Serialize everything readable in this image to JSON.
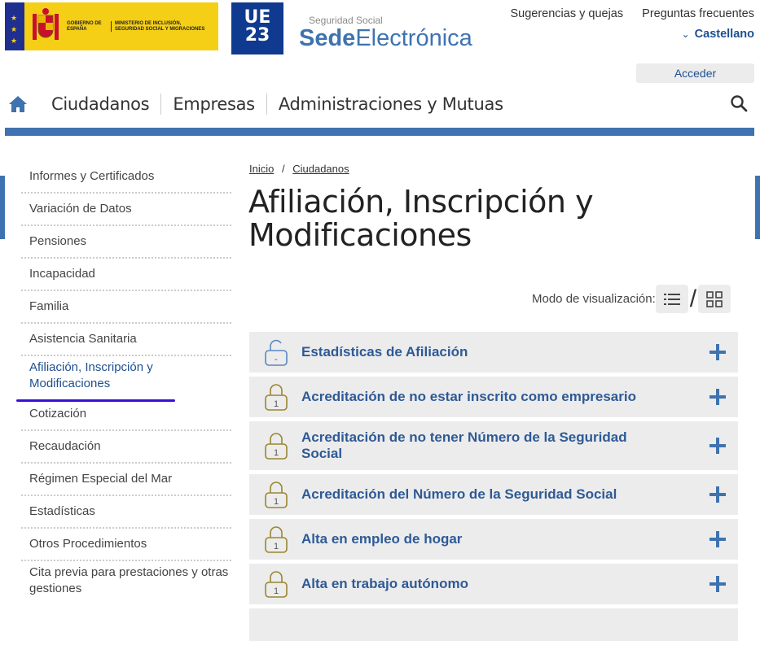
{
  "header": {
    "gov_text_1": "GOBIERNO DE ESPAÑA",
    "gov_text_2": "MINISTERIO DE INCLUSIÓN, SEGURIDAD SOCIAL Y MIGRACIONES",
    "u23_line1": "UE",
    "u23_line2": "23",
    "sede_small": "Seguridad Social",
    "sede_bold": "Sede",
    "sede_light": "Electrónica",
    "link_suggestions": "Sugerencias y quejas",
    "link_faq": "Preguntas frecuentes",
    "language": "Castellano",
    "login_button": "Acceder"
  },
  "nav": {
    "items": [
      "Ciudadanos",
      "Empresas",
      "Administraciones y Mutuas"
    ]
  },
  "sidebar": {
    "items": [
      "Informes y Certificados",
      "Variación de Datos",
      "Pensiones",
      "Incapacidad",
      "Familia",
      "Asistencia Sanitaria",
      "Afiliación, Inscripción y Modificaciones",
      "Cotización",
      "Recaudación",
      "Régimen Especial del Mar",
      "Estadísticas",
      "Otros Procedimientos",
      "Cita previa para prestaciones y otras gestiones"
    ],
    "active_index": 6
  },
  "breadcrumb": {
    "home": "Inicio",
    "separator": "/",
    "section": "Ciudadanos"
  },
  "page_title": "Afiliación, Inscripción y Modificaciones",
  "view_mode": {
    "label": "Modo de visualización:",
    "separator": "/"
  },
  "procedures": [
    {
      "label": "Estadísticas de Afiliación",
      "lock": "open",
      "lock_text": "-"
    },
    {
      "label": "Acreditación de no estar inscrito como empresario",
      "lock": "closed",
      "lock_text": "1"
    },
    {
      "label": "Acreditación de no tener Número de la Seguridad Social",
      "lock": "closed",
      "lock_text": "1"
    },
    {
      "label": "Acreditación del Número de la Seguridad Social",
      "lock": "closed",
      "lock_text": "1"
    },
    {
      "label": "Alta en empleo de hogar",
      "lock": "closed",
      "lock_text": "1"
    },
    {
      "label": "Alta en trabajo autónomo",
      "lock": "closed",
      "lock_text": "1"
    }
  ],
  "colors": {
    "brand_blue": "#3e73b0",
    "link_blue": "#2e5a96",
    "active_underline": "#3a0fd6",
    "lock_gold": "#9a8530",
    "lock_open_blue": "#5a86c0",
    "item_bg": "#ececec"
  }
}
